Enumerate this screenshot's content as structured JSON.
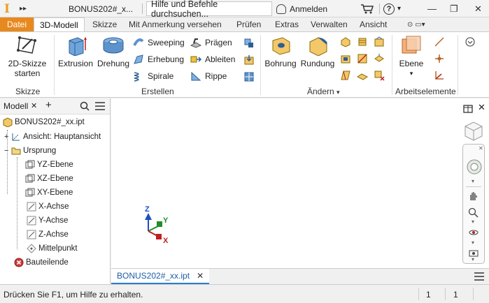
{
  "titlebar": {
    "logo": "I",
    "arrows": "▸▸",
    "document": "BONUS202#_x...",
    "help_placeholder": "Hilfe und Befehle durchsuchen...",
    "sign_in": "Anmelden",
    "help_symbol": "?",
    "dropdown": "▾",
    "minimize": "—",
    "restore": "❐",
    "close": "✕"
  },
  "tabs": [
    {
      "label": "Datei"
    },
    {
      "label": "3D-Modell"
    },
    {
      "label": "Skizze"
    },
    {
      "label": "Mit Anmerkung versehen"
    },
    {
      "label": "Prüfen"
    },
    {
      "label": "Extras"
    },
    {
      "label": "Verwalten"
    },
    {
      "label": "Ansicht"
    }
  ],
  "ribbon": {
    "sketch_button": "2D-Skizze\nstarten",
    "sketch_line1": "2D-Skizze",
    "sketch_line2": "starten",
    "group_sketch": "Skizze",
    "extrusion": "Extrusion",
    "revolve": "Drehung",
    "sweep": "Sweeping",
    "loft": "Erhebung",
    "coil": "Spirale",
    "emboss": "Prägen",
    "derive": "Ableiten",
    "rib": "Rippe",
    "group_create": "Erstellen",
    "hole": "Bohrung",
    "fillet": "Rundung",
    "group_modify": "Ändern",
    "plane_line1": "Ebene",
    "group_work": "Arbeitselemente",
    "dropdown_arrow": "▾"
  },
  "browser": {
    "tab_label": "Modell",
    "close": "✕",
    "add": "+",
    "items": [
      {
        "label": "BONUS202#_xx.ipt"
      },
      {
        "label": "Ansicht: Hauptansicht"
      },
      {
        "label": "Ursprung"
      },
      {
        "label": "YZ-Ebene"
      },
      {
        "label": "XZ-Ebene"
      },
      {
        "label": "XY-Ebene"
      },
      {
        "label": "X-Achse"
      },
      {
        "label": "Y-Achse"
      },
      {
        "label": "Z-Achse"
      },
      {
        "label": "Mittelpunkt"
      },
      {
        "label": "Bauteilende"
      }
    ]
  },
  "viewport": {
    "axis_x": "X",
    "axis_y": "Y",
    "axis_z": "Z",
    "doc_tab": "BONUS202#_xx.ipt",
    "doc_tab_close": "✕"
  },
  "status": {
    "message": "Drücken Sie F1, um Hilfe zu erhalten.",
    "count1": "1",
    "count2": "1"
  },
  "colors": {
    "accent": "#e8891f",
    "tab_underline": "#2a7fd0",
    "axis_x": "#c02020",
    "axis_y": "#1e8f2a",
    "axis_z": "#1f4fbf"
  }
}
